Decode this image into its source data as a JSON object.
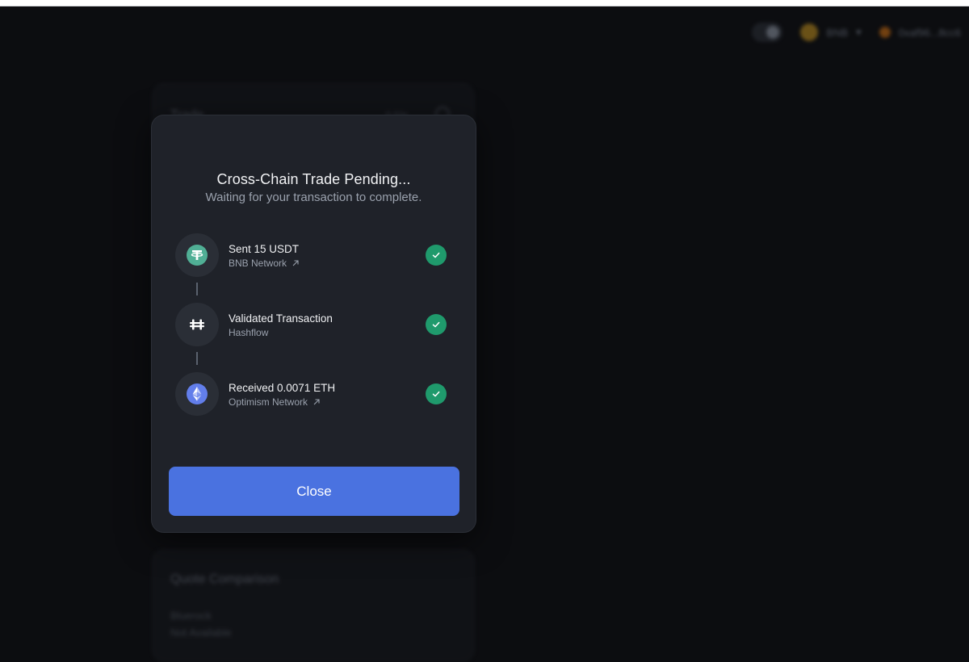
{
  "background": {
    "trade_card_title": "Trade",
    "trade_card_meta": "0.5%",
    "quote_card_title": "Quote Comparison",
    "quote_line_1": "Bluerock",
    "quote_line_2": "Not Available",
    "chain_label": "BNB",
    "wallet_label": "0xaf96...8cc6"
  },
  "modal": {
    "title": "Cross-Chain Trade Pending...",
    "subtitle": "Waiting for your transaction to complete.",
    "steps": [
      {
        "title": "Sent 15 USDT",
        "subtitle": "BNB Network",
        "icon": "tether-icon",
        "status": "complete",
        "external_link": true
      },
      {
        "title": "Validated Transaction",
        "subtitle": "Hashflow",
        "icon": "hashflow-icon",
        "status": "complete",
        "external_link": false
      },
      {
        "title": "Received 0.0071 ETH",
        "subtitle": "Optimism Network",
        "icon": "ethereum-icon",
        "status": "complete",
        "external_link": true
      }
    ],
    "close_label": "Close"
  },
  "colors": {
    "accent": "#4a72e0",
    "success": "#1f9a6c",
    "tether": "#50af95",
    "ethereum": "#627eea",
    "modal_bg": "#1f2229"
  }
}
